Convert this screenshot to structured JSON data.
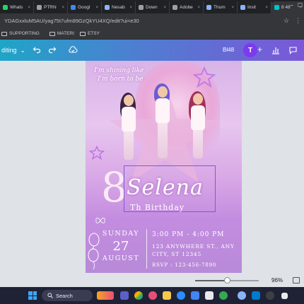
{
  "browser": {
    "tabs": [
      {
        "label": "Whats",
        "color": "#25d366"
      },
      {
        "label": "PTRN",
        "color": "#9aa0a6"
      },
      {
        "label": "Googl",
        "color": "#4285f4"
      },
      {
        "label": "Nesab",
        "color": "#8ab4f8"
      },
      {
        "label": "Down",
        "color": "#9aa0a6"
      },
      {
        "label": "Adobe",
        "color": "#9aa0a6"
      },
      {
        "label": "Thum",
        "color": "#8ab4f8"
      },
      {
        "label": "Insit",
        "color": "#8ab4f8"
      },
      {
        "label": "8 48",
        "color": "#00c4cc"
      }
    ],
    "url": "YDAGxxluM5AU/yag75t7ufm89GzQkYU4XQ/edit?ui=e30",
    "bookmarks": [
      "SUPPORTING",
      "MATERI",
      "ETSY"
    ]
  },
  "toolbar": {
    "editing_label": "diting",
    "chevron": "⌄",
    "design_size": "Bl48",
    "avatar_initial": "T",
    "icons": {
      "undo": "undo-icon",
      "redo": "redo-icon",
      "cloud": "cloud-sync-icon",
      "plus": "plus-icon",
      "chart": "analytics-icon",
      "comment": "comment-icon"
    }
  },
  "card": {
    "tagline_line1": "I'm shining like",
    "tagline_line2": "I'm born to be",
    "age": "8",
    "name": "Selena",
    "birthday": "Th Birthday",
    "day": "SUNDAY",
    "date": "27",
    "month": "AUGUST",
    "time": "3:00 PM - 4:00 PM",
    "address_line1": "123 ANYWHERE ST., ANY",
    "address_line2": "CITY, ST 12345",
    "rsvp": "RSVP : 123-456-7890"
  },
  "zoom": {
    "percent_label": "96%",
    "value": 0.96
  },
  "taskbar": {
    "search_label": "Search"
  }
}
